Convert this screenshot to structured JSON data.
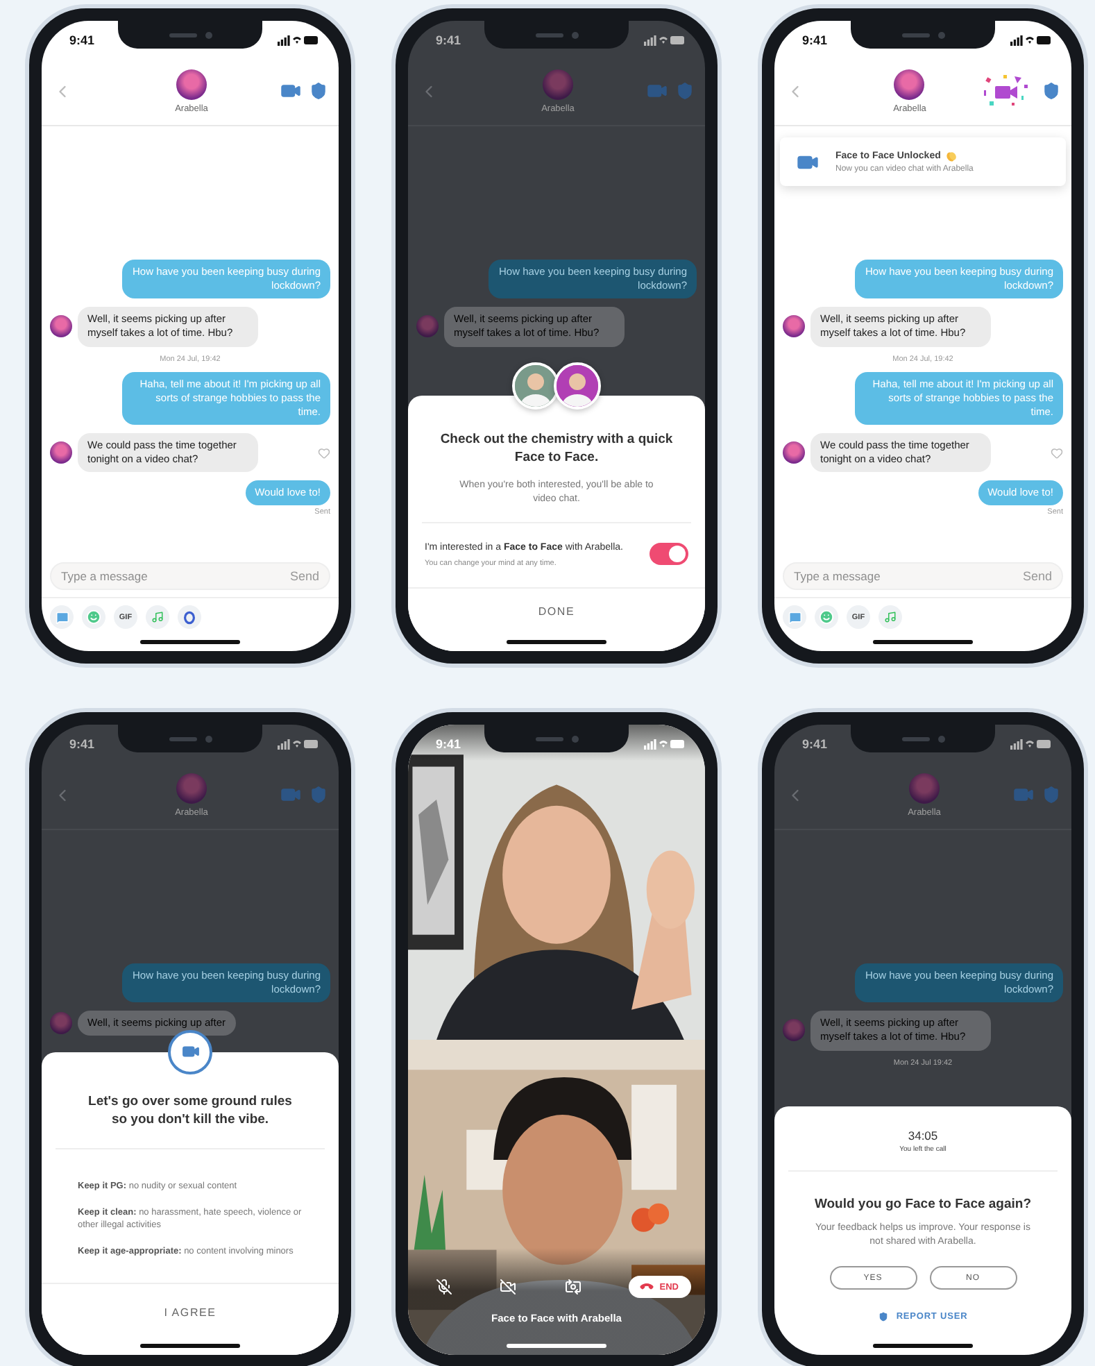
{
  "phones": [
    {
      "kind": "chat",
      "status": {
        "time": "9:41"
      },
      "header": {
        "name": "Arabella"
      },
      "messages": [
        {
          "kind": "sent",
          "text": "How have you been keeping busy during lockdown?"
        },
        {
          "kind": "received",
          "text": "Well, it seems picking up after myself takes a lot of time. Hbu?"
        },
        {
          "kind": "date",
          "text": "Mon 24 Jul, 19:42"
        },
        {
          "kind": "sent",
          "text": "Haha, tell me about it! I'm picking up all sorts of strange hobbies to pass the time."
        },
        {
          "kind": "received",
          "text": "We could pass the time together tonight on a video chat?",
          "like_button": true
        },
        {
          "kind": "sent",
          "text": "Would love to!"
        },
        {
          "kind": "status",
          "text": "Sent"
        }
      ],
      "composer": {
        "placeholder": "Type a message",
        "send": "Send"
      },
      "tools": [
        {
          "kind": "chat"
        },
        {
          "kind": "sticker"
        },
        {
          "kind": "gif",
          "label": "GIF"
        },
        {
          "kind": "music"
        },
        {
          "kind": "ring"
        }
      ]
    },
    {
      "kind": "chat",
      "dimmed": true,
      "status": {
        "time": "9:41"
      },
      "header": {
        "name": "Arabella"
      },
      "messages": [
        {
          "kind": "sent",
          "text": "How have you been keeping busy during lockdown?"
        },
        {
          "kind": "received",
          "text": "Well, it seems picking up after myself takes a lot of time. Hbu?"
        }
      ],
      "sheet": {
        "kind": "consent",
        "title": "Check out the chemistry with a quick Face to Face.",
        "text": "When you're both interested, you'll be able to video chat.",
        "toggle": {
          "label": "I'm interested in a **Face to Face** with Arabella.",
          "hint": "You can change your mind at any time.",
          "on": true
        },
        "button": "DONE"
      }
    },
    {
      "kind": "chat",
      "status": {
        "time": "9:41"
      },
      "header": {
        "name": "Arabella",
        "confetti": true
      },
      "toast": {
        "title": "Face to Face Unlocked",
        "text": "Now you can video chat with Arabella"
      },
      "messages": [
        {
          "kind": "sent",
          "text": "How have you been keeping busy during lockdown?"
        },
        {
          "kind": "received",
          "text": "Well, it seems picking up after myself takes a lot of time. Hbu?"
        },
        {
          "kind": "date",
          "text": "Mon 24 Jul, 19:42"
        },
        {
          "kind": "sent",
          "text": "Haha, tell me about it! I'm picking up all sorts of strange hobbies to pass the time."
        },
        {
          "kind": "received",
          "text": "We could pass the time together tonight on a video chat?",
          "like_button": true
        },
        {
          "kind": "sent",
          "text": "Would love to!"
        },
        {
          "kind": "status",
          "text": "Sent"
        }
      ],
      "composer": {
        "placeholder": "Type a message",
        "send": "Send"
      },
      "tools": [
        {
          "kind": "chat"
        },
        {
          "kind": "sticker"
        },
        {
          "kind": "gif",
          "label": "GIF"
        },
        {
          "kind": "music"
        }
      ]
    },
    {
      "kind": "chat",
      "dimmed": true,
      "status": {
        "time": "9:41"
      },
      "header": {
        "name": "Arabella"
      },
      "messages": [
        {
          "kind": "sent",
          "text": "How have you been keeping busy during lockdown?"
        },
        {
          "kind": "received",
          "text": "Well, it seems picking up after"
        }
      ],
      "sheet": {
        "kind": "rules",
        "title": "Let's go over some ground rules so you don't kill the vibe.",
        "rules": [
          "**Keep it PG:** no nudity or sexual content",
          "**Keep it clean:** no harassment, hate speech, violence or other illegal activities",
          "**Keep it age-appropriate:** no content involving minors"
        ],
        "button": "I AGREE"
      }
    },
    {
      "kind": "video",
      "status": {
        "time": "9:41"
      },
      "controls": [
        {
          "kind": "mic_off"
        },
        {
          "kind": "camera_off"
        },
        {
          "kind": "flip"
        },
        {
          "kind": "end",
          "label": "END"
        }
      ],
      "caption": "Face to Face with Arabella"
    },
    {
      "kind": "chat",
      "dimmed": true,
      "status": {
        "time": "9:41"
      },
      "header": {
        "name": "Arabella"
      },
      "messages": [
        {
          "kind": "sent",
          "text": "How have you been keeping busy during lockdown?"
        },
        {
          "kind": "received",
          "text": "Well, it seems picking up after myself takes a lot of time. Hbu?"
        },
        {
          "kind": "date",
          "text": "Mon 24 Jul 19:42"
        }
      ],
      "sheet": {
        "kind": "feedback",
        "timer": "34:05",
        "timer_note": "You left the call",
        "title": "Would you go Face to Face again?",
        "text": "Your feedback helps us improve. Your response is not shared with Arabella.",
        "buttons": [
          "YES",
          "NO"
        ],
        "link": "REPORT USER"
      }
    }
  ]
}
